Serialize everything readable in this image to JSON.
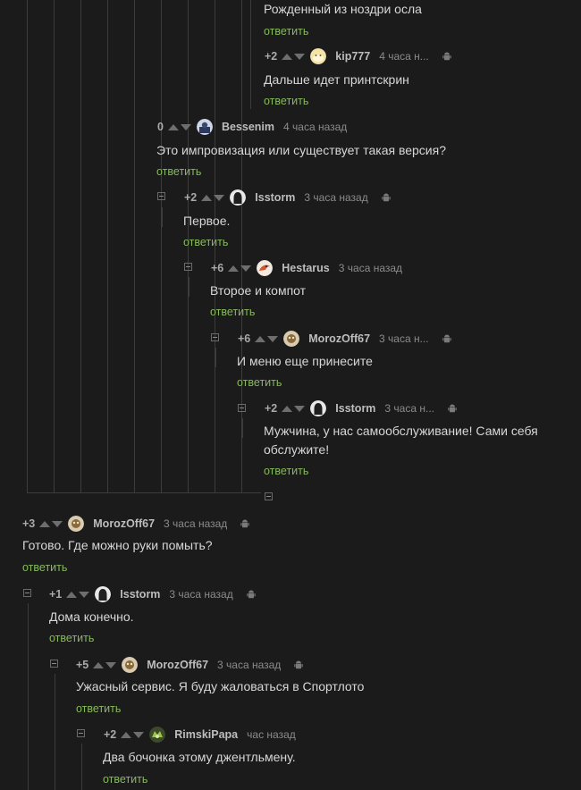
{
  "reply_label": "ответить",
  "comments": [
    {
      "rating": "",
      "nick": "",
      "time": "",
      "text": "Рожденный из ноздри осла"
    },
    {
      "rating": "+2",
      "nick": "kip777",
      "time": "4 часа н...",
      "text": "Дальше идет принтскрин"
    },
    {
      "rating": "0",
      "nick": "Bessenim",
      "time": "4 часа назад",
      "text": "Это импровизация или существует такая версия?"
    },
    {
      "rating": "+2",
      "nick": "Isstorm",
      "time": "3 часа назад",
      "text": "Первое."
    },
    {
      "rating": "+6",
      "nick": "Hestarus",
      "time": "3 часа назад",
      "text": "Второе и компот"
    },
    {
      "rating": "+6",
      "nick": "MorozOff67",
      "time": "3 часа н...",
      "text": "И меню еще принесите"
    },
    {
      "rating": "+2",
      "nick": "Isstorm",
      "time": "3 часа н...",
      "text_line1": "Мужчина, у нас самообслуживание! Сами себя",
      "text_line2": "обслужите!"
    },
    {
      "rating": "+3",
      "nick": "MorozOff67",
      "time": "3 часа назад",
      "text": "Готово. Где можно руки помыть?"
    },
    {
      "rating": "+1",
      "nick": "Isstorm",
      "time": "3 часа назад",
      "text": "Дома конечно."
    },
    {
      "rating": "+5",
      "nick": "MorozOff67",
      "time": "3 часа назад",
      "text": "Ужасный сервис. Я буду жаловаться в Спортлото"
    },
    {
      "rating": "+2",
      "nick": "RimskiPapa",
      "time": "час назад",
      "text": "Два бочонка этому джентльмену."
    }
  ],
  "colors": {
    "background": "#1b1b1b",
    "reply_link": "#86b95c",
    "thread_line": "#3c3c3c"
  }
}
